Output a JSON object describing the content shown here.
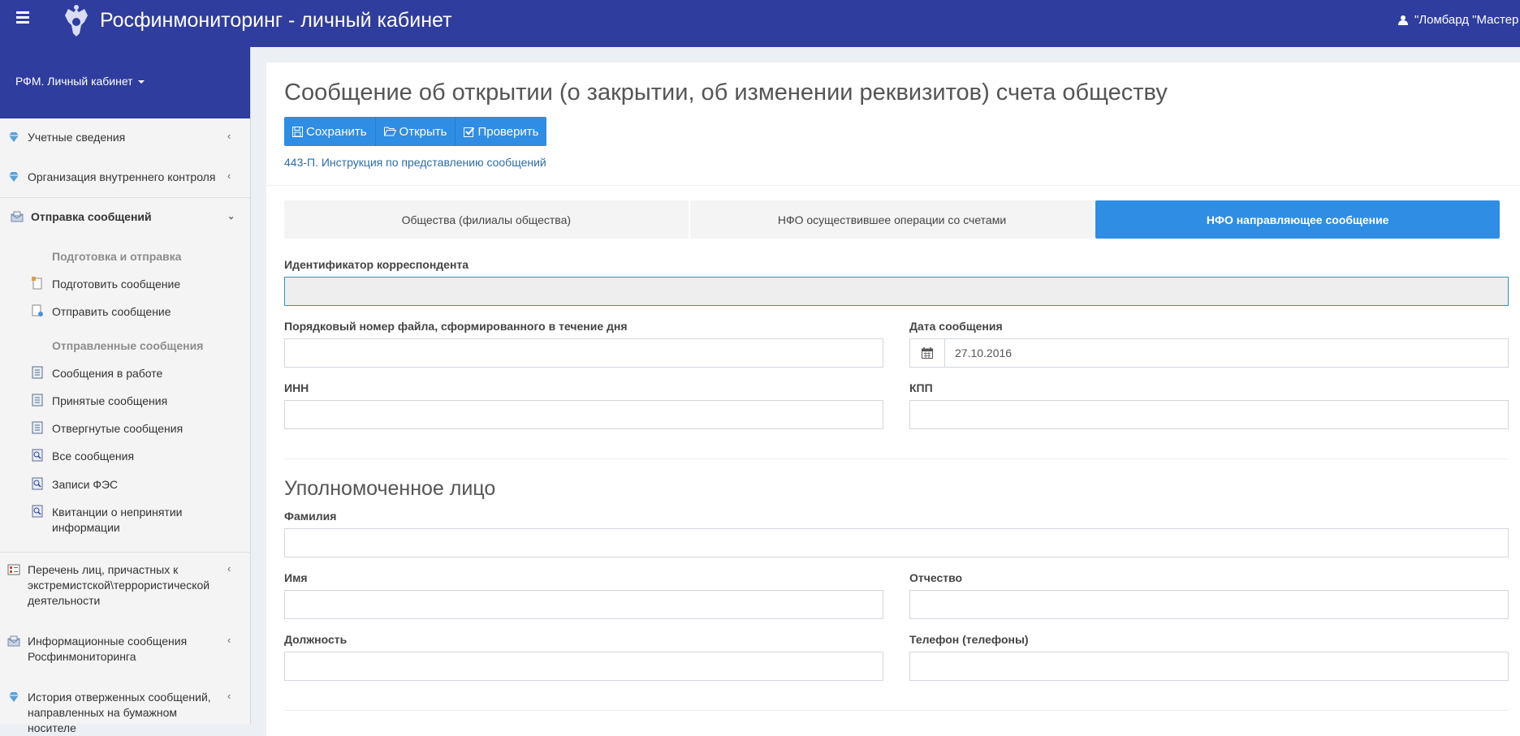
{
  "header": {
    "title": "Росфинмониторинг - личный кабинет",
    "user": "\"Ломбард \"Мастер"
  },
  "sidebar": {
    "head_label": "РФМ. Личный кабинет",
    "items": [
      {
        "label": "Учетные сведения",
        "icon": "diamond-icon"
      },
      {
        "label": "Организация внутреннего контроля",
        "icon": "diamond-icon"
      },
      {
        "label": "Отправка сообщений",
        "icon": "envelope-icon"
      },
      {
        "label": "Перечень лиц, причастных к экстремистской\\террористической деятельности",
        "icon": "list-icon"
      },
      {
        "label": "Информационные сообщения Росфинмониторинга",
        "icon": "envelope-icon"
      },
      {
        "label": "История отверженных сообщений, направленных на бумажном носителе",
        "icon": "diamond-icon"
      }
    ],
    "sub_heads": [
      "Подготовка и отправка",
      "Отправленные сообщения"
    ],
    "sub_items": [
      "Подготовить сообщение",
      "Отправить сообщение",
      "Сообщения в работе",
      "Принятые сообщения",
      "Отвергнутые сообщения",
      "Все сообщения",
      "Записи ФЭС",
      "Квитанции о непринятии информации"
    ]
  },
  "main": {
    "title": "Сообщение об открытии (о закрытии, об изменении реквизитов) счета обществу",
    "buttons": {
      "save": "Сохранить",
      "open": "Открыть",
      "check": "Проверить"
    },
    "instruction_link": "443-П. Инструкция по представлению сообщений",
    "tabs": [
      "Общества (филиалы общества)",
      "НФО осуществившее операции со счетами",
      "НФО направляющее сообщение"
    ],
    "active_tab": 2,
    "fields": {
      "correspondent_id": {
        "label": "Идентификатор корреспондента",
        "value": ""
      },
      "file_number": {
        "label": "Порядковый номер файла, сформированного в течение дня",
        "value": ""
      },
      "message_date": {
        "label": "Дата сообщения",
        "value": "27.10.2016"
      },
      "inn": {
        "label": "ИНН",
        "value": ""
      },
      "kpp": {
        "label": "КПП",
        "value": ""
      }
    },
    "section_title": "Уполномоченное лицо",
    "person": {
      "last_name": {
        "label": "Фамилия",
        "value": ""
      },
      "first_name": {
        "label": "Имя",
        "value": ""
      },
      "patronymic": {
        "label": "Отчество",
        "value": ""
      },
      "position": {
        "label": "Должность",
        "value": ""
      },
      "phone": {
        "label": "Телефон (телефоны)",
        "value": ""
      }
    }
  },
  "colors": {
    "header": "#2f3d9e",
    "accent": "#2f8de4",
    "link": "#2c6ca6"
  }
}
